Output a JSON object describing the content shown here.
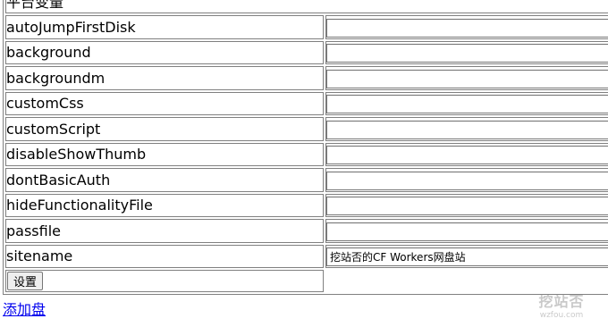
{
  "table": {
    "caption": "平台变量",
    "rows": [
      {
        "name": "autoJumpFirstDisk",
        "value": ""
      },
      {
        "name": "background",
        "value": ""
      },
      {
        "name": "backgroundm",
        "value": ""
      },
      {
        "name": "customCss",
        "value": ""
      },
      {
        "name": "customScript",
        "value": ""
      },
      {
        "name": "disableShowThumb",
        "value": ""
      },
      {
        "name": "dontBasicAuth",
        "value": ""
      },
      {
        "name": "hideFunctionalityFile",
        "value": ""
      },
      {
        "name": "passfile",
        "value": ""
      },
      {
        "name": "sitename",
        "value": "挖站否的CF Workers网盘站"
      }
    ],
    "submit_label": "设置"
  },
  "links": {
    "add_disk": "添加盘"
  },
  "watermark": {
    "main": "挖站否",
    "sub": "wzfou.com"
  }
}
